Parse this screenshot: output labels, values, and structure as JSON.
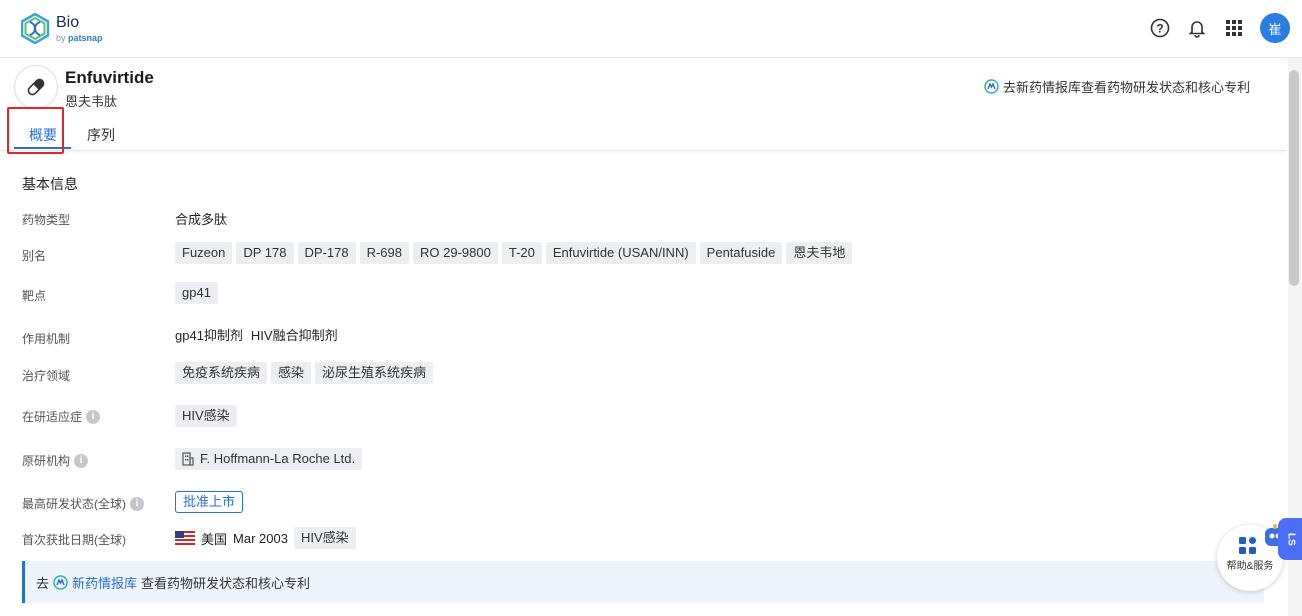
{
  "brand": {
    "name": "Bio",
    "by_prefix": "by",
    "by_name": "patsnap"
  },
  "user": {
    "avatar_text": "崔"
  },
  "drug": {
    "title": "Enfuvirtide",
    "subtitle": "恩夫韦肽",
    "header_link": "去新药情报库查看药物研发状态和核心专利"
  },
  "tabs": [
    {
      "label": "概要",
      "active": true
    },
    {
      "label": "序列",
      "active": false
    }
  ],
  "basic_info": {
    "section_title": "基本信息",
    "drug_type": {
      "label": "药物类型",
      "value": "合成多肽"
    },
    "aliases": {
      "label": "别名",
      "values": [
        "Fuzeon",
        "DP 178",
        "DP-178",
        "R-698",
        "RO 29-9800",
        "T-20",
        "Enfuvirtide (USAN/INN)",
        "Pentafuside",
        "恩夫韦地"
      ]
    },
    "target": {
      "label": "靶点",
      "values": [
        "gp41"
      ]
    },
    "mechanism": {
      "label": "作用机制",
      "values": [
        "gp41抑制剂",
        "HIV融合抑制剂"
      ]
    },
    "therapeutic_area": {
      "label": "治疗领域",
      "values": [
        "免疫系统疾病",
        "感染",
        "泌尿生殖系统疾病"
      ]
    },
    "indication": {
      "label": "在研适应症",
      "values": [
        "HIV感染"
      ]
    },
    "originator": {
      "label": "原研机构",
      "value": "F. Hoffmann-La Roche Ltd."
    },
    "highest_status": {
      "label": "最高研发状态(全球)",
      "value": "批准上市"
    },
    "first_approval": {
      "label": "首次获批日期(全球)",
      "country": "美国",
      "date": "Mar 2003",
      "indication": "HIV感染"
    }
  },
  "banner": {
    "prefix": "去",
    "link": "新药情报库",
    "suffix": "查看药物研发状态和核心专利"
  },
  "help": {
    "label": "帮助&服务",
    "badge": "LS"
  },
  "colors": {
    "accent": "#2a6fd1",
    "highlight_box": "#e0262a",
    "avatar": "#2a7de1"
  }
}
